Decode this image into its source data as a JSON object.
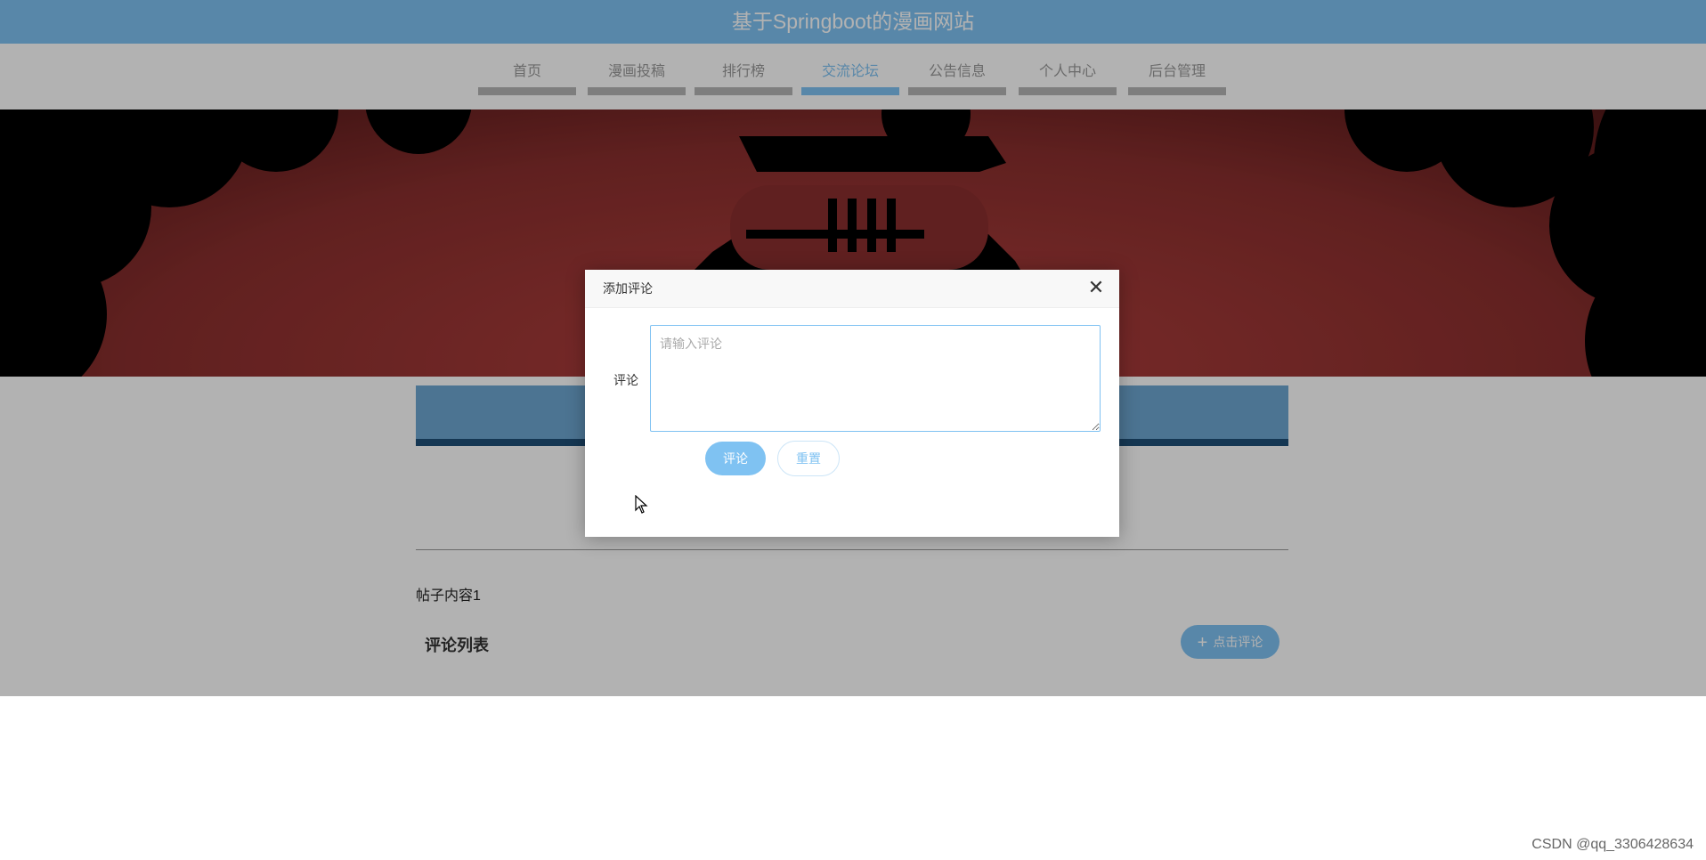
{
  "site": {
    "title": "基于Springboot的漫画网站"
  },
  "nav": {
    "items": [
      {
        "label": "首页",
        "active": false
      },
      {
        "label": "漫画投稿",
        "active": false
      },
      {
        "label": "排行榜",
        "active": false
      },
      {
        "label": "交流论坛",
        "active": true
      },
      {
        "label": "公告信息",
        "active": false
      },
      {
        "label": "个人中心",
        "active": false
      },
      {
        "label": "后台管理",
        "active": false
      }
    ]
  },
  "post": {
    "content": "帖子内容1",
    "comments_title": "评论列表",
    "add_comment_button": "点击评论"
  },
  "modal": {
    "title": "添加评论",
    "field_label": "评论",
    "textarea_placeholder": "请输入评论",
    "submit_label": "评论",
    "reset_label": "重置"
  },
  "watermark": "CSDN @qq_3306428634",
  "colors": {
    "accent": "#7fc2f2",
    "nav_inactive_bar": "#b5b5b5"
  }
}
